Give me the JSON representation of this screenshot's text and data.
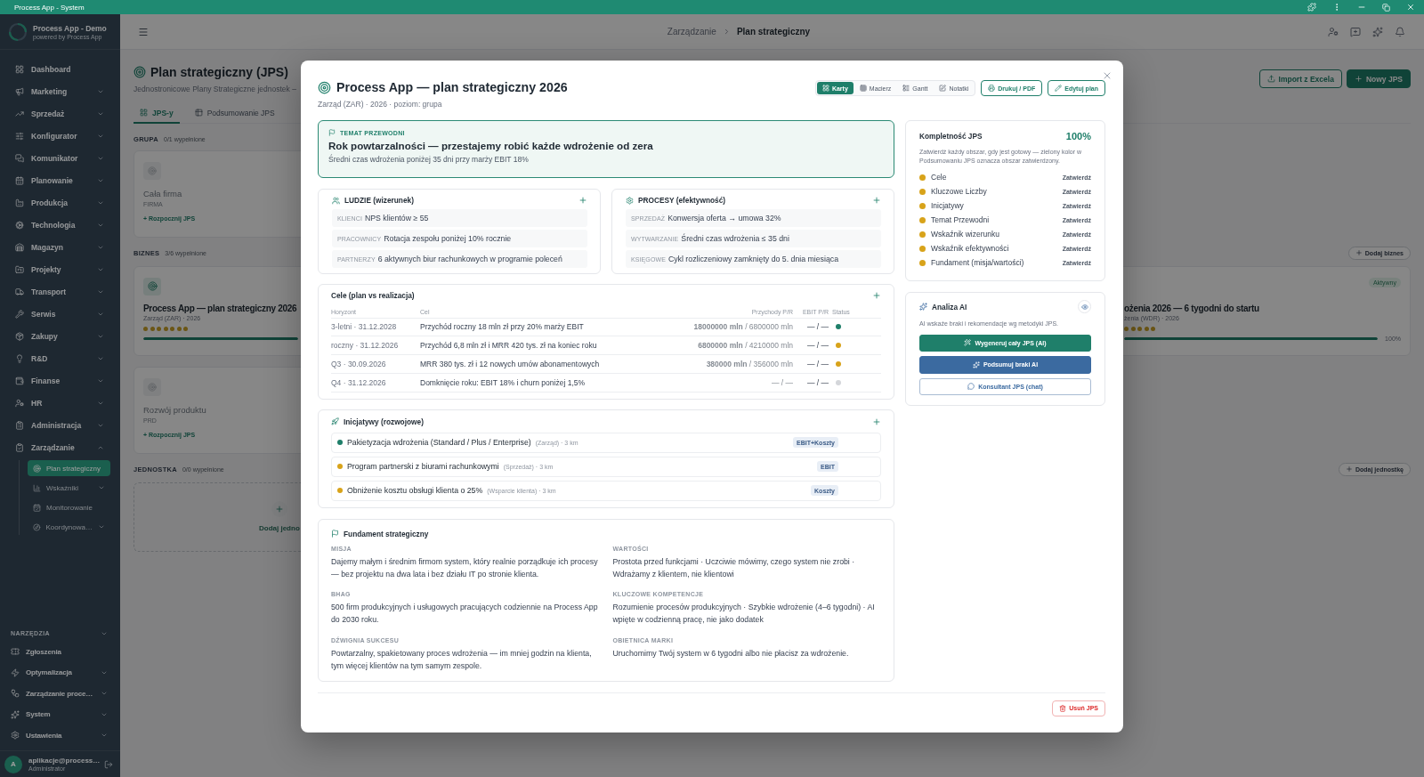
{
  "title_bar": {
    "title": "Process App - System"
  },
  "sidebar": {
    "brand": {
      "name": "Process App - Demo",
      "tagline": "powered by Process App"
    },
    "items": [
      {
        "label": "Dashboard",
        "kind": "link",
        "selected": false
      },
      {
        "label": "Marketing",
        "kind": "group",
        "expanded": false,
        "selected": false
      },
      {
        "label": "Sprzedaż",
        "kind": "group",
        "expanded": false,
        "selected": false
      },
      {
        "label": "Konfigurator",
        "kind": "group",
        "expanded": false,
        "selected": false
      },
      {
        "label": "Komunikator",
        "kind": "group",
        "expanded": false,
        "selected": false
      },
      {
        "label": "Planowanie",
        "kind": "group",
        "expanded": false,
        "selected": false
      },
      {
        "label": "Produkcja",
        "kind": "group",
        "expanded": false,
        "selected": false
      },
      {
        "label": "Technologia",
        "kind": "group",
        "expanded": false,
        "selected": false
      },
      {
        "label": "Magazyn",
        "kind": "group",
        "expanded": false,
        "selected": false
      },
      {
        "label": "Projekty",
        "kind": "group",
        "expanded": false,
        "selected": false
      },
      {
        "label": "Transport",
        "kind": "group",
        "expanded": false,
        "selected": false
      },
      {
        "label": "Serwis",
        "kind": "group",
        "expanded": false,
        "selected": false
      },
      {
        "label": "Zakupy",
        "kind": "group",
        "expanded": false,
        "selected": false
      },
      {
        "label": "R&D",
        "kind": "group",
        "expanded": false,
        "selected": false
      },
      {
        "label": "Finanse",
        "kind": "group",
        "expanded": false,
        "selected": false
      },
      {
        "label": "HR",
        "kind": "group",
        "expanded": false,
        "selected": false
      },
      {
        "label": "Administracja",
        "kind": "group",
        "expanded": false,
        "selected": false
      },
      {
        "label": "Zarządzanie",
        "kind": "group",
        "expanded": true,
        "selected": false,
        "children": [
          {
            "label": "Plan strategiczny",
            "kind": "link",
            "selected": true
          },
          {
            "label": "Wskaźniki",
            "kind": "group",
            "expanded": false,
            "selected": false
          },
          {
            "label": "Monitorowanie",
            "kind": "link",
            "selected": false
          },
          {
            "label": "Koordynowa…",
            "kind": "group",
            "expanded": false,
            "selected": false
          }
        ]
      }
    ],
    "tools": {
      "label": "NARZĘDZIA",
      "items": [
        {
          "label": "Zgłoszenia",
          "kind": "link",
          "selected": false
        },
        {
          "label": "Optymalizacja",
          "kind": "group",
          "expanded": false,
          "selected": false
        },
        {
          "label": "Zarządzanie proce…",
          "kind": "group",
          "expanded": false,
          "selected": false
        },
        {
          "label": "System",
          "kind": "group",
          "expanded": false,
          "selected": false
        },
        {
          "label": "Ustawienia",
          "kind": "group",
          "expanded": false,
          "selected": false
        }
      ]
    },
    "user": {
      "avatar": "A",
      "name": "aplikacje@process…",
      "role": "Administrator"
    }
  },
  "header": {
    "breadcrumb": [
      "Zarządzanie",
      "Plan strategiczny"
    ]
  },
  "page": {
    "title": "Plan strategiczny (JPS)",
    "subtitle": "Jednostronicowe Plany Strategiczne jednostek –",
    "actions": [
      {
        "kind": "import",
        "label": "Import z Excela"
      },
      {
        "kind": "create",
        "label": "Nowy JPS"
      }
    ],
    "tabs": [
      {
        "label": "JPS-y",
        "selected": true
      },
      {
        "label": "Podsumowanie JPS",
        "selected": false
      }
    ],
    "sections": [
      {
        "name": "GRUPA",
        "count": "0/1 wypełnione",
        "cards": [
          {
            "kind": "empty",
            "title": "Cała firma",
            "code": "FIRMA",
            "action": "+ Rozpocznij JPS"
          }
        ]
      },
      {
        "name": "BIZNES",
        "count": "3/6 wypełnione",
        "add": "Dodaj biznes",
        "cards": [
          {
            "kind": "plan",
            "title": "Process App — plan strategiczny 2026",
            "meta": "Zarząd (ZAR) · 2026",
            "stars": 7,
            "level": 1
          },
          {
            "kind": "plan",
            "badge": "Aktywny",
            "title": "ożenia 2026 — 6 tygodni do startu",
            "meta": "żenia (WDR) · 2026",
            "stars": 5,
            "level": 1,
            "reading": "100%"
          },
          {
            "kind": "empty",
            "title": "Rozwój produktu",
            "code": "PRD",
            "action": "+ Rozpocznij JPS"
          }
        ]
      },
      {
        "name": "JEDNOSTKA",
        "count": "0/0 wypełnione",
        "add": "Dodaj jednostkę",
        "cards": [
          {
            "kind": "add",
            "title": "Dodaj jedno"
          }
        ]
      }
    ]
  },
  "modal": {
    "title": "Process App — plan strategiczny 2026",
    "subtitle": "Zarząd (ZAR) · 2026 · poziom: grupa",
    "views": [
      {
        "label": "Karty",
        "selected": true
      },
      {
        "label": "Macierz",
        "selected": false
      },
      {
        "label": "Gantt",
        "selected": false
      },
      {
        "label": "Notatki",
        "selected": false
      }
    ],
    "actions": [
      {
        "kind": "print",
        "label": "Drukuj / PDF"
      },
      {
        "kind": "edit",
        "label": "Edytuj plan"
      }
    ],
    "theme": {
      "label": "TEMAT PRZEWODNI",
      "title": "Rok powtarzalności — przestajemy robić każde wdrożenie od zera",
      "subtitle": "Średni czas wdrożenia poniżej 35 dni przy marży EBIT 18%"
    },
    "indicators": [
      {
        "kind": "people",
        "title": "LUDZIE (wizerunek)",
        "rows": [
          {
            "tag": "KLIENCI",
            "text": "NPS klientów ≥ 55"
          },
          {
            "tag": "PRACOWNICY",
            "text": "Rotacja zespołu poniżej 10% rocznie"
          },
          {
            "tag": "PARTNERZY",
            "text": "6 aktywnych biur rachunkowych w programie poleceń"
          }
        ]
      },
      {
        "kind": "process",
        "title": "PROCESY (efektywność)",
        "rows": [
          {
            "tag": "SPRZEDAŻ",
            "text": "Konwersja oferta → umowa 32%"
          },
          {
            "tag": "WYTWARZANIE",
            "text": "Średni czas wdrożenia ≤ 35 dni"
          },
          {
            "tag": "KSIĘGOWE",
            "text": "Cykl rozliczeniowy zamknięty do 5. dnia miesiąca"
          }
        ]
      }
    ],
    "goals": {
      "title": "Cele (plan vs realizacja)",
      "columns": [
        "Horyzont",
        "Cel",
        "Przychody P/R",
        "EBIT P/R",
        "Status"
      ],
      "rows": [
        {
          "horizon": "3-letni · 31.12.2028",
          "goal": "Przychód roczny 18 mln zł przy 20% marży EBIT",
          "revenue": "**18000000 mln** / 6800000 mln",
          "ebit": "— / —",
          "color": "#1f7f6a"
        },
        {
          "horizon": "roczny · 31.12.2026",
          "goal": "Przychód 6,8 mln zł i MRR 420 tys. zł na koniec roku",
          "revenue": "**6800000 mln** / 4210000 mln",
          "ebit": "— / —",
          "color": "#d8a31a"
        },
        {
          "horizon": "Q3 · 30.09.2026",
          "goal": "MRR 380 tys. zł i 12 nowych umów abonamentowych",
          "revenue": "**380000 mln** / 356000 mln",
          "ebit": "— / —",
          "color": "#d8a31a"
        },
        {
          "horizon": "Q4 · 31.12.2026",
          "goal": "Domknięcie roku: EBIT 18% i churn poniżej 1,5%",
          "revenue": "— / —",
          "ebit": "— / —",
          "color": "#d4d6da"
        }
      ]
    },
    "initiatives": {
      "title": "Inicjatywy (rozwojowe)",
      "items": [
        {
          "title": "Pakietyzacja wdrożenia (Standard / Plus / Enterprise)",
          "note": "(Zarząd) · 3 km",
          "tag": "EBIT+Koszty",
          "color": "#1f7f6a"
        },
        {
          "title": "Program partnerski z biurami rachunkowymi",
          "note": "(Sprzedaż) · 3 km",
          "tag": "EBIT",
          "color": "#d8a31a"
        },
        {
          "title": "Obniżenie kosztu obsługi klienta o 25%",
          "note": "(Wsparcie klienta) · 3 km",
          "tag": "Koszty",
          "color": "#d8a31a"
        }
      ]
    },
    "foundation": {
      "title": "Fundament strategiczny",
      "fields": [
        {
          "label": "MISJA",
          "text": "Dajemy małym i średnim firmom system, który realnie porządkuje ich procesy — bez projektu na dwa lata i bez działu IT po stronie klienta."
        },
        {
          "label": "WARTOŚCI",
          "text": "Prostota przed funkcjami · Uczciwie mówimy, czego system nie zrobi · Wdrażamy z klientem, nie klientowi"
        },
        {
          "label": "BHAG",
          "text": "500 firm produkcyjnych i usługowych pracujących codziennie na Process App do 2030 roku."
        },
        {
          "label": "KLUCZOWE KOMPETENCJE",
          "text": "Rozumienie procesów produkcyjnych · Szybkie wdrożenie (4–6 tygodni) · AI wpięte w codzienną pracę, nie jako dodatek"
        },
        {
          "label": "DŹWIGNIA SUKCESU",
          "text": "Powtarzalny, spakietowany proces wdrożenia — im mniej godzin na klienta, tym więcej klientów na tym samym zespole."
        },
        {
          "label": "OBIETNICA MARKI",
          "text": "Uruchomimy Twój system w 6 tygodni albo nie płacisz za wdrożenie."
        }
      ]
    },
    "delete": "Usuń JPS",
    "completeness": {
      "title": "Kompletność JPS",
      "value": "100%",
      "note": "Zatwierdź każdy obszar, gdy jest gotowy — zielony kolor w Podsumowaniu JPS oznacza obszar zatwierdzony.",
      "items": [
        {
          "label": "Cele",
          "approved": false,
          "action": "Zatwierdź"
        },
        {
          "label": "Kluczowe Liczby",
          "approved": false,
          "action": "Zatwierdź"
        },
        {
          "label": "Inicjatywy",
          "approved": false,
          "action": "Zatwierdź"
        },
        {
          "label": "Temat Przewodni",
          "approved": false,
          "action": "Zatwierdź"
        },
        {
          "label": "Wskaźnik wizerunku",
          "approved": false,
          "action": "Zatwierdź"
        },
        {
          "label": "Wskaźnik efektywności",
          "approved": false,
          "action": "Zatwierdź"
        },
        {
          "label": "Fundament (misja/wartości)",
          "approved": false,
          "action": "Zatwierdź"
        }
      ]
    },
    "ai": {
      "title": "Analiza AI",
      "note": "AI wskaże braki i rekomendacje wg metodyki JPS.",
      "buttons": [
        {
          "kind": "generate",
          "label": "Wygeneruj cały JPS (AI)"
        },
        {
          "kind": "summary",
          "label": "Podsumuj braki AI"
        },
        {
          "kind": "chat",
          "label": "Konsultant JPS (chat)"
        }
      ]
    }
  }
}
